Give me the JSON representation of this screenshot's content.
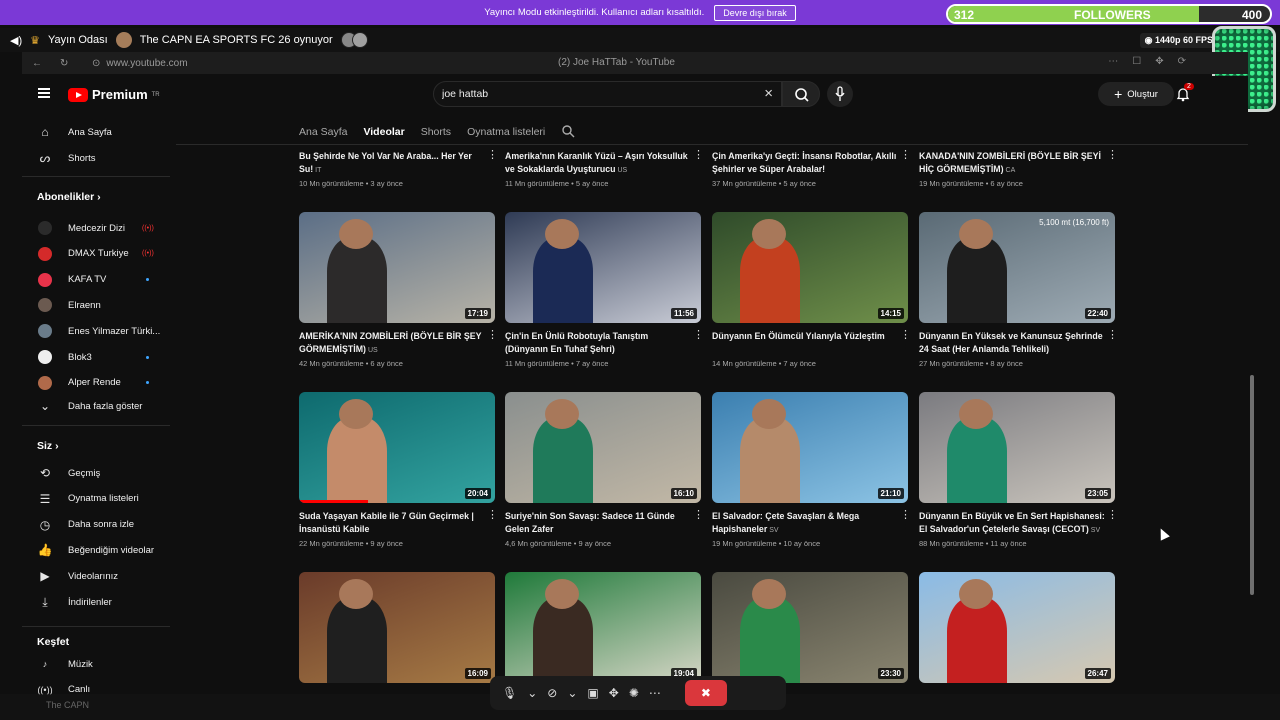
{
  "banner": {
    "text": "Yayıncı Modu etkinleştirildi. Kullanıcı adları kısaltıldı.",
    "button": "Devre dışı bırak"
  },
  "followers": {
    "current": "312",
    "label": "FOLLOWERS",
    "goal": "400",
    "progress": 0.78
  },
  "stream": {
    "room": "Yayın Odası",
    "status": "The CAPN EA SPORTS FC 26 oynuyor",
    "quality": "1440p 60 FPS"
  },
  "browser": {
    "url": "www.youtube.com",
    "tab_title": "(2) Joe HaTTab - YouTube"
  },
  "youtube": {
    "logo_text": "Premium",
    "logo_region": "TR",
    "search_value": "joe hattab",
    "create_label": "Oluştur",
    "notification_count": "2",
    "sidebar": {
      "home": "Ana Sayfa",
      "shorts": "Shorts",
      "subscriptions_head": "Abonelikler",
      "channels": [
        {
          "name": "Medcezir Dizi",
          "live": true,
          "color": "#2b2b2b"
        },
        {
          "name": "DMAX Turkiye",
          "live": true,
          "color": "#d42a2a"
        },
        {
          "name": "KAFA TV",
          "live": false,
          "dot": true,
          "color": "#e8334a"
        },
        {
          "name": "Elraenn",
          "live": false,
          "dot": false,
          "color": "#6b5a50"
        },
        {
          "name": "Enes Yilmazer Türki...",
          "live": false,
          "dot": false,
          "color": "#6a7c8a"
        },
        {
          "name": "Blok3",
          "live": false,
          "dot": true,
          "color": "#eeeeee"
        },
        {
          "name": "Alper Rende",
          "live": false,
          "dot": true,
          "color": "#b06a4a"
        }
      ],
      "show_more": "Daha fazla göster",
      "you_head": "Siz",
      "you_items": [
        "Geçmiş",
        "Oynatma listeleri",
        "Daha sonra izle",
        "Beğendiğim videolar",
        "Videolarınız",
        "İndirilenler"
      ],
      "explore_head": "Keşfet",
      "explore_items": [
        "Müzik",
        "Canlı"
      ]
    },
    "tabs": [
      "Ana Sayfa",
      "Videolar",
      "Shorts",
      "Oynatma listeleri"
    ],
    "active_tab": "Videolar",
    "rows": [
      [
        {
          "title": "Bu Şehirde Ne Yol Var Ne Araba... Her Yer Su!",
          "cc": "IT",
          "meta": "10 Mn görüntüleme • 3 ay önce"
        },
        {
          "title": "Amerika'nın Karanlık Yüzü – Aşırı Yoksulluk ve Sokaklarda Uyuşturucu",
          "cc": "US",
          "meta": "11 Mn görüntüleme • 5 ay önce"
        },
        {
          "title": "Çin Amerika'yı Geçti: İnsansı Robotlar, Akıllı Şehirler ve Süper Arabalar!",
          "cc": "",
          "meta": "37 Mn görüntüleme • 5 ay önce"
        },
        {
          "title": "KANADA'NIN ZOMBİLERİ (BÖYLE BİR ŞEYİ HİÇ GÖRMEMİŞTİM)",
          "cc": "CA",
          "meta": "19 Mn görüntüleme • 6 ay önce"
        }
      ],
      [
        {
          "title": "AMERİKA'NIN ZOMBİLERİ (BÖYLE BİR ŞEY GÖRMEMİŞTİM)",
          "cc": "US",
          "meta": "42 Mn görüntüleme • 6 ay önce",
          "duration": "17:19",
          "colors": [
            "#5b6e86",
            "#b7b3a7",
            "#2c2a2a"
          ]
        },
        {
          "title": "Çin'in En Ünlü Robotuyla Tanıştım (Dünyanın En Tuhaf Şehri)",
          "cc": "",
          "meta": "11 Mn görüntüleme • 7 ay önce",
          "duration": "11:56",
          "colors": [
            "#2f3b55",
            "#c9ccd6",
            "#1b2a55"
          ]
        },
        {
          "title": "Dünyanın En Ölümcül Yılanıyla Yüzleştim",
          "cc": "",
          "meta": "14 Mn görüntüleme • 7 ay önce",
          "duration": "14:15",
          "colors": [
            "#2f4b2a",
            "#6f8f4a",
            "#c3401f"
          ]
        },
        {
          "title": "Dünyanın En Yüksek ve Kanunsuz Şehrinde 24 Saat (Her Anlamda Tehlikeli)",
          "cc": "",
          "meta": "27 Mn görüntüleme • 8 ay önce",
          "duration": "22:40",
          "overlay": "5,100 mt (16,700 ft)",
          "colors": [
            "#5a6a75",
            "#9eabb4",
            "#1e1e1e"
          ]
        }
      ],
      [
        {
          "title": "Suda Yaşayan Kabile ile 7 Gün Geçirmek | İnsanüstü Kabile",
          "cc": "",
          "meta": "22 Mn görüntüleme • 9 ay önce",
          "duration": "20:04",
          "progress": 0.35,
          "colors": [
            "#0e6a6e",
            "#33a3a0",
            "#c48b6a"
          ]
        },
        {
          "title": "Suriye'nin Son Savaşı: Sadece 11 Günde Gelen Zafer",
          "cc": "",
          "meta": "4,6 Mn görüntüleme • 9 ay önce",
          "duration": "16:10",
          "colors": [
            "#8a8f8e",
            "#c2b8a6",
            "#1f7a5a"
          ]
        },
        {
          "title": "El Salvador: Çete Savaşları & Mega Hapishaneler",
          "cc": "SV",
          "meta": "19 Mn görüntüleme • 10 ay önce",
          "duration": "21:10",
          "colors": [
            "#3b7fb0",
            "#8cc3e4",
            "#b58a6a"
          ]
        },
        {
          "title": "Dünyanın En Büyük ve En Sert Hapishanesi: El Salvador'un Çetelerle Savaşı (CECOT)",
          "cc": "SV",
          "meta": "88 Mn görüntüleme • 11 ay önce",
          "duration": "23:05",
          "colors": [
            "#7b7b80",
            "#c9c4bc",
            "#1f8a6a"
          ]
        }
      ],
      [
        {
          "title": "",
          "cc": "",
          "meta": "",
          "duration": "16:09",
          "colors": [
            "#6a3b2a",
            "#a67a45",
            "#1f1f1f"
          ]
        },
        {
          "title": "",
          "cc": "",
          "meta": "",
          "duration": "19:04",
          "colors": [
            "#1f7a3a",
            "#d6d6c6",
            "#3a2a22"
          ]
        },
        {
          "title": "",
          "cc": "",
          "meta": "",
          "duration": "23:30",
          "colors": [
            "#4a4a40",
            "#8a8570",
            "#2a8a4a"
          ]
        },
        {
          "title": "",
          "cc": "",
          "meta": "",
          "duration": "26:47",
          "colors": [
            "#8abbe6",
            "#d6c8b0",
            "#c42020"
          ]
        }
      ]
    ]
  },
  "taskbar": {
    "label": "The CAPN"
  }
}
